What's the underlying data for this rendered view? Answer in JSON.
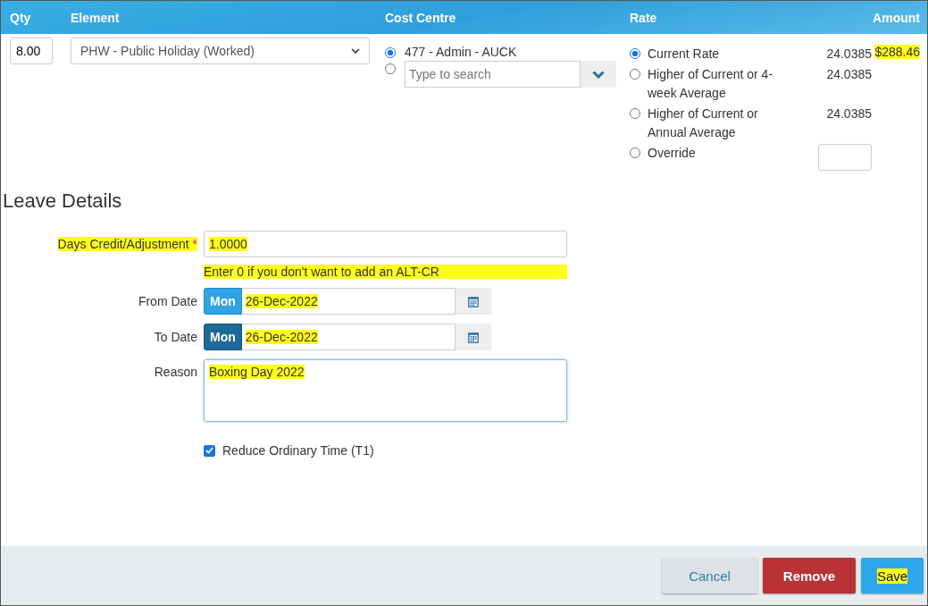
{
  "header": {
    "columns": [
      "Qty",
      "Element",
      "Cost Centre",
      "Rate",
      "Amount"
    ]
  },
  "line": {
    "qty": "8.00",
    "element": "PHW - Public Holiday (Worked)",
    "cost_centres": [
      {
        "kind": "option",
        "label": "477 - Admin - AUCK",
        "selected": true
      },
      {
        "kind": "search",
        "placeholder": "Type to search",
        "selected": false
      }
    ],
    "rates": [
      {
        "kind": "fixed",
        "label": "Current Rate",
        "value": "24.0385",
        "selected": true
      },
      {
        "kind": "fixed",
        "label": "Higher of Current or 4-week Average",
        "value": "24.0385",
        "selected": false
      },
      {
        "kind": "fixed",
        "label": "Higher of Current or Annual Average",
        "value": "24.0385",
        "selected": false
      },
      {
        "kind": "input",
        "label": "Override",
        "selected": false
      }
    ],
    "amount": {
      "text": "$288.46",
      "highlighted": true
    }
  },
  "leave": {
    "title": "Leave Details",
    "days": {
      "label": "Days Credit/Adjustment",
      "required_mark": "*",
      "value": "1.0000",
      "highlighted": true
    },
    "hint": {
      "text": "Enter 0 if you don't want to add an ALT-CR",
      "highlighted": true
    },
    "dates": [
      {
        "label": "From Date",
        "day": "Mon",
        "value": "26-Dec-2022",
        "pressed": false,
        "highlighted": true
      },
      {
        "label": "To Date",
        "day": "Mon",
        "value": "26-Dec-2022",
        "pressed": true,
        "highlighted": true
      }
    ],
    "reason": {
      "label": "Reason",
      "value": "Boxing Day 2022",
      "highlighted": true
    },
    "reduce": {
      "label": "Reduce Ordinary Time (T1)",
      "checked": true
    }
  },
  "buttons": [
    {
      "kind": "default",
      "label": "Cancel",
      "highlighted": false
    },
    {
      "kind": "danger",
      "label": "Remove",
      "highlighted": false
    },
    {
      "kind": "primary",
      "label": "Save",
      "highlighted": true
    }
  ]
}
